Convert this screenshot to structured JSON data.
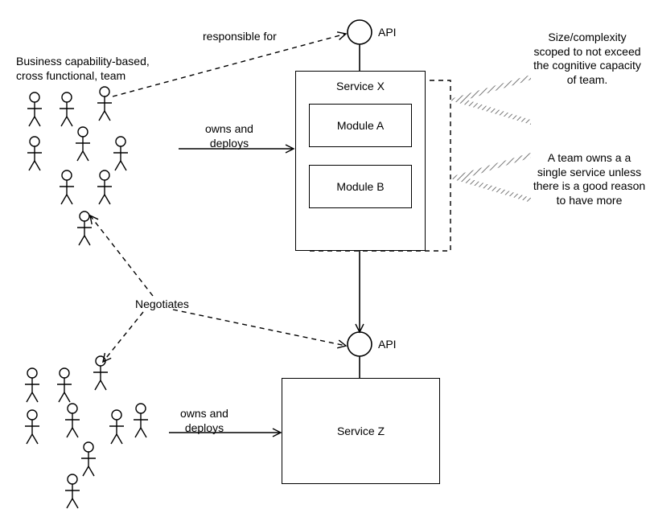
{
  "labels": {
    "team_caption": "Business capability-based,\ncross functional, team",
    "responsible_for": "responsible for",
    "owns_deploys_1": "owns and\ndeploys",
    "owns_deploys_2": "owns and\ndeploys",
    "negotiates": "Negotiates",
    "api_1": "API",
    "api_2": "API",
    "service_x": "Service X",
    "module_a": "Module A",
    "module_b": "Module B",
    "service_z": "Service Z",
    "cognitive": "Size/complexity\nscoped to not exceed\nthe cognitive capacity\nof team.",
    "single_service": "A team owns a a\nsingle service unless\nthere is a good reason\nto have more"
  }
}
